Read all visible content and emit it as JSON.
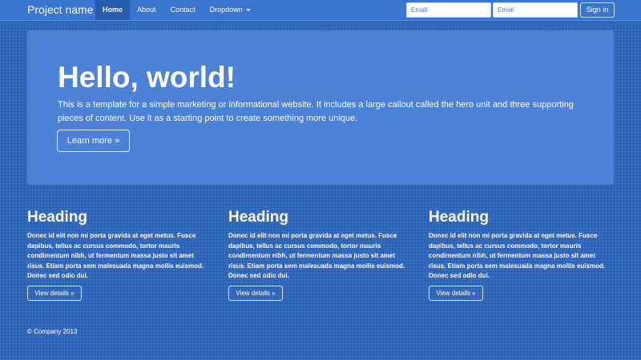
{
  "navbar": {
    "brand": "Project name",
    "items": [
      {
        "label": "Home",
        "active": true
      },
      {
        "label": "About",
        "active": false
      },
      {
        "label": "Contact",
        "active": false
      },
      {
        "label": "Dropdown",
        "active": false
      }
    ],
    "email_placeholder_1": "Email",
    "email_placeholder_2": "Email",
    "signin_label": "Sign in"
  },
  "hero": {
    "title": "Hello, world!",
    "text": "This is a template for a simple marketing or informational website. It includes a large callout called the hero unit and three supporting pieces of content. Use it as a starting point to create something more unique.",
    "button_label": "Learn more »"
  },
  "columns": [
    {
      "heading": "Heading",
      "text": "Donec id elit non mi porta gravida at eget metus. Fusce dapibus, tellus ac cursus commodo, tortor mauris condimentum nibh, ut fermentum massa justo sit amet risus. Etiam porta sem malesuada magna mollis euismod. Donec sed odio dui.",
      "button_label": "View details »"
    },
    {
      "heading": "Heading",
      "text": "Donec id elit non mi porta gravida at eget metus. Fusce dapibus, tellus ac cursus commodo, tortor mauris condimentum nibh, ut fermentum massa justo sit amet risus. Etiam porta sem malesuada magna mollis euismod. Donec sed odio dui.",
      "button_label": "View details »"
    },
    {
      "heading": "Heading",
      "text": "Donec id elit non mi porta gravida at eget metus. Fusce dapibus, tellus ac cursus commodo, tortor mauris condimentum nibh, ut fermentum massa justo sit amet risus. Etiam porta sem malesuada magna mollis euismod. Donec sed odio dui.",
      "button_label": "View details »"
    }
  ],
  "footer": {
    "text": "© Company 2013"
  },
  "colors": {
    "page_background": "#2e64b8",
    "navbar_background": "#3b74cf",
    "nav_active_background": "#2a5cad",
    "hero_background": "#4a80d6",
    "text": "#ffffff"
  },
  "icons": {
    "dropdown_caret": "chevron-down-icon"
  }
}
